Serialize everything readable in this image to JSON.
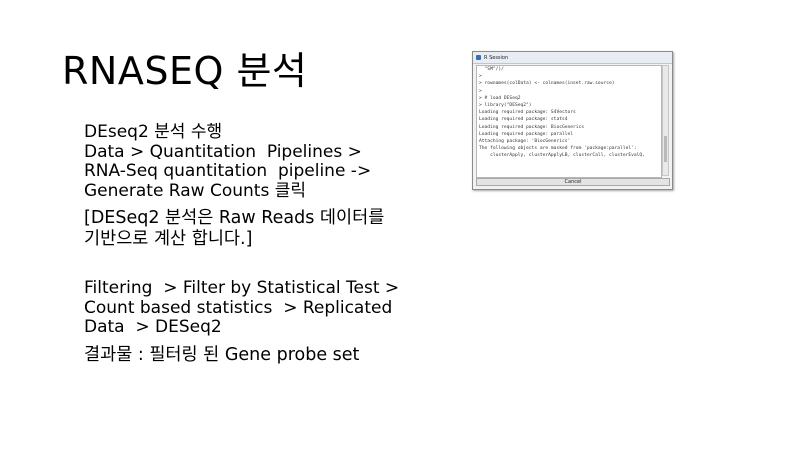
{
  "slide": {
    "title": "RNASEQ 분석",
    "block1": "DEseq2 분석 수행\nData > Quantitation  Pipelines >\nRNA-Seq quantitation  pipeline ->\nGenerate Raw Counts 클릭",
    "block2": "[DESeq2 분석은 Raw Reads 데이터를\n기반으로 계산 합니다.]",
    "block3": "Filtering  > Filter by Statistical Test >\nCount based statistics  > Replicated\nData  > DESeq2",
    "block4": "결과물 : 필터링 된 Gene probe set"
  },
  "r_window": {
    "title": "R Session",
    "lines": [
      "  \"SM\"/)/",
      ">",
      "> rownames(colData) <- colnames(inset.raw.source)",
      ">",
      "> # load DESeq2",
      "> library(\"DESeq2\")",
      "Loading required package: S4Vectors",
      "Loading required package: stats4",
      "Loading required package: BiocGenerics",
      "Loading required package: parallel",
      "",
      "Attaching package: 'BiocGenerics'",
      "",
      "The following objects are masked from 'package:parallel':",
      "",
      "    clusterApply, clusterApplyLB, clusterCall, clusterEvalQ,"
    ],
    "cancel_label": "Cancel"
  }
}
